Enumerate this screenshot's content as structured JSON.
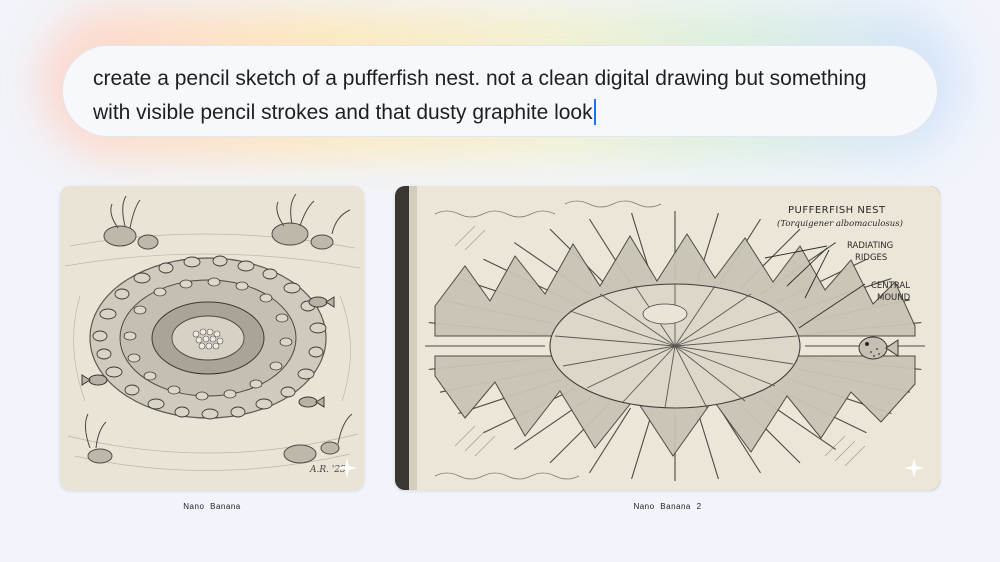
{
  "prompt": {
    "line1": "create a pencil sketch of a pufferfish nest. not a clean digital drawing but something",
    "line2": "with visible pencil strokes and that dusty graphite look"
  },
  "images": [
    {
      "caption": "Nano Banana",
      "signature": "A.R. '23"
    },
    {
      "caption": "Nano Banana 2",
      "annotations": {
        "title": "PUFFERFISH NEST",
        "species": "(Torquigener albomaculosus)",
        "ridges_line1": "RADIATING",
        "ridges_line2": "RIDGES",
        "mound_line1": "CENTRAL",
        "mound_line2": "MOUND"
      }
    }
  ],
  "colors": {
    "accent": "#1a73e8",
    "paper": "#e8e3d4",
    "graphite": "#5a5a5a"
  },
  "icons": [
    "sparkle-icon"
  ]
}
